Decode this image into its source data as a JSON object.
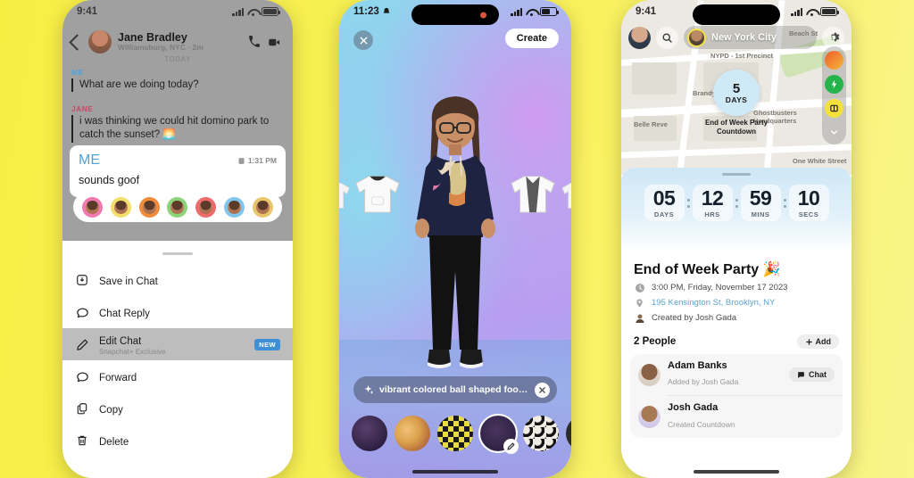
{
  "background": {
    "color": "#f9f14a"
  },
  "phone1": {
    "status": {
      "time": "9:41"
    },
    "header": {
      "name": "Jane Bradley",
      "subtitle": "Williamsburg, NYC · 2m",
      "back_icon": "back-chevron-icon",
      "call_icon": "phone-call-icon",
      "video_icon": "video-call-icon"
    },
    "day_divider": "TODAY",
    "messages": [
      {
        "sender": "ME",
        "text": "What are we doing today?"
      },
      {
        "sender": "JANE",
        "text": "i was thinking we could hit domino park to catch the sunset? 🌅"
      }
    ],
    "selected_message": {
      "sender": "ME",
      "time": "1:31 PM",
      "text": "sounds goof"
    },
    "reaction_count": 7,
    "menu": [
      {
        "label": "Save in Chat",
        "sub": "",
        "icon": "save-icon",
        "badge": "",
        "highlighted": false
      },
      {
        "label": "Chat Reply",
        "sub": "",
        "icon": "reply-icon",
        "badge": "",
        "highlighted": false
      },
      {
        "label": "Edit Chat",
        "sub": "Snapchat+ Exclusive",
        "icon": "pencil-icon",
        "badge": "NEW",
        "highlighted": true
      },
      {
        "label": "Forward",
        "sub": "",
        "icon": "forward-icon",
        "badge": "",
        "highlighted": false
      },
      {
        "label": "Copy",
        "sub": "",
        "icon": "copy-icon",
        "badge": "",
        "highlighted": false
      },
      {
        "label": "Delete",
        "sub": "",
        "icon": "trash-icon",
        "badge": "",
        "highlighted": false
      }
    ]
  },
  "phone2": {
    "status": {
      "time": "11:23",
      "mute_icon": "bell-mute-icon"
    },
    "close_label": "×",
    "create_label": "Create",
    "prompt": {
      "text": "vibrant colored ball shaped food p...",
      "sparkle_icon": "sparkle-icon",
      "clear_icon": "close-icon"
    },
    "stickers": [
      {
        "name": "dark-floral-sticker",
        "selected": false
      },
      {
        "name": "colorful-confetti-sticker",
        "selected": false
      },
      {
        "name": "yellow-crown-sticker",
        "selected": false
      },
      {
        "name": "food-plate-sticker",
        "selected": true
      },
      {
        "name": "white-balls-sticker",
        "selected": false
      },
      {
        "name": "edge-sticker",
        "selected": false
      }
    ]
  },
  "phone3": {
    "status": {
      "time": "9:41"
    },
    "map": {
      "city": "New York City",
      "search_icon": "search-icon",
      "settings_icon": "gear-icon",
      "labels": [
        "Beach St",
        "NYPD - 1st Precinct",
        "Brandy",
        "Belle Reve",
        "Ghostbusters Headquarters",
        "One White Street"
      ],
      "bubble": {
        "number": "5",
        "unit": "DAYS",
        "caption": "End of Week Party\nCountdown"
      },
      "rail_icons": [
        "heat-map-icon",
        "friend-activity-icon",
        "places-icon",
        "chevron-down-icon"
      ]
    },
    "countdown": [
      {
        "value": "05",
        "unit": "DAYS"
      },
      {
        "value": "12",
        "unit": "HRS"
      },
      {
        "value": "59",
        "unit": "MINS"
      },
      {
        "value": "10",
        "unit": "SECS"
      }
    ],
    "event": {
      "title": "End of Week Party 🎉",
      "time": "3:00 PM, Friday, November 17 2023",
      "location": "195 Kensington St, Brooklyn, NY",
      "creator": "Created by Josh Gada",
      "time_icon": "clock-icon",
      "location_icon": "pin-icon",
      "creator_icon": "person-icon"
    },
    "people": {
      "heading": "2 People",
      "add_label": "Add",
      "add_icon": "plus-icon",
      "rows": [
        {
          "name": "Adam Banks",
          "sub": "Added by Josh Gada",
          "action": "Chat",
          "action_icon": "chat-bubble-icon"
        },
        {
          "name": "Josh Gada",
          "sub": "Created Countdown",
          "action": "",
          "action_icon": ""
        }
      ]
    }
  }
}
